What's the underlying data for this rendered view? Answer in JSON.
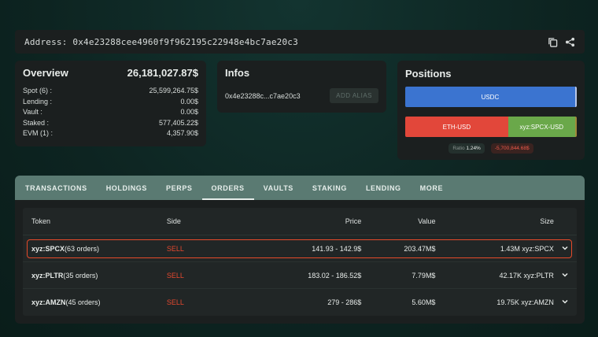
{
  "address": {
    "label": "Address: 0x4e23288cee4960f9f962195c22948e4bc7ae20c3"
  },
  "overview": {
    "title": "Overview",
    "total": "26,181,027.87$",
    "rows": [
      {
        "label": "Spot (6) :",
        "value": "25,599,264.75$"
      },
      {
        "label": "Lending :",
        "value": "0.00$"
      },
      {
        "label": "Vault :",
        "value": "0.00$"
      },
      {
        "label": "Staked :",
        "value": "577,405.22$"
      },
      {
        "label": "EVM (1) :",
        "value": "4,357.90$"
      }
    ]
  },
  "infos": {
    "title": "Infos",
    "short_address": "0x4e23288c...c7ae20c3",
    "alias_button": "ADD ALIAS"
  },
  "positions": {
    "title": "Positions",
    "bar1": [
      {
        "label": "USDC",
        "color": "#3b74d0",
        "share": 0.99
      }
    ],
    "bar2": [
      {
        "label": "ETH-USD",
        "color": "#e2473a",
        "share": 0.6
      },
      {
        "label": "xyz:SPCX-USD",
        "color": "#6aa84a",
        "share": 0.39
      }
    ],
    "ratio_label": "Ratio",
    "ratio_value": "1.24%",
    "pnl": "-5,700,844.68$"
  },
  "tabs": [
    "TRANSACTIONS",
    "HOLDINGS",
    "PERPS",
    "ORDERS",
    "VAULTS",
    "STAKING",
    "LENDING",
    "MORE"
  ],
  "active_tab": "ORDERS",
  "orders": {
    "columns": {
      "token": "Token",
      "side": "Side",
      "price": "Price",
      "value": "Value",
      "size": "Size"
    },
    "rows": [
      {
        "token": "xyz:SPCX",
        "count": "(63 orders)",
        "side": "SELL",
        "price": "141.93 - 142.9$",
        "value": "203.47M$",
        "size": "1.43M xyz:SPCX"
      },
      {
        "token": "xyz:PLTR",
        "count": "(35 orders)",
        "side": "SELL",
        "price": "183.02 - 186.52$",
        "value": "7.79M$",
        "size": "42.17K xyz:PLTR"
      },
      {
        "token": "xyz:AMZN",
        "count": "(45 orders)",
        "side": "SELL",
        "price": "279 - 286$",
        "value": "5.60M$",
        "size": "19.75K xyz:AMZN"
      }
    ]
  },
  "colors": {
    "sell": "#e5482f",
    "highlight": "#e64a2a",
    "tab_bar": "#5a7a72"
  }
}
